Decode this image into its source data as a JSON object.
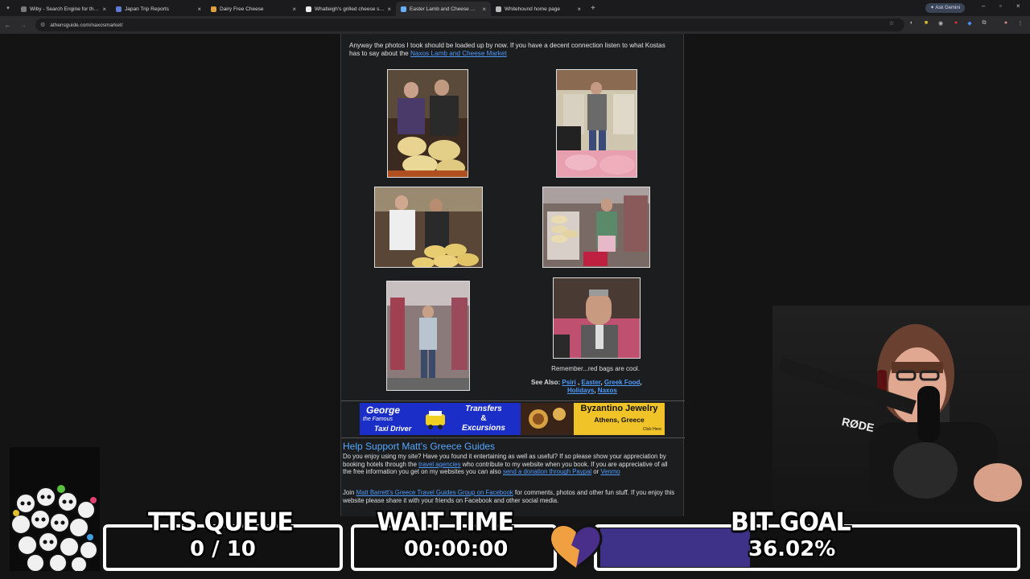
{
  "browser": {
    "tabs": [
      {
        "title": "Wiby - Search Engine for the Cl",
        "color": "#7a7a7a",
        "active": false
      },
      {
        "title": "Japan Trip Reports",
        "color": "#5e7bd6",
        "active": false
      },
      {
        "title": "Dairy Free Cheese",
        "color": "#e0a040",
        "active": false
      },
      {
        "title": "Whatleigh's grilled cheese sand",
        "color": "#eeeeee",
        "active": false
      },
      {
        "title": "Easter Lamb and Cheese Marke",
        "color": "#6ab0ff",
        "active": true
      },
      {
        "title": "Whitehound home page",
        "color": "#bbbbbb",
        "active": false
      }
    ],
    "gemini_label": "Ask Gemini",
    "url": "athensguide.com/naxosmarket/"
  },
  "page": {
    "intro_text": "Anyway the photos I took should be loaded up by now. If you have a decent connection listen to what Kostas has to say about the ",
    "intro_link": "Naxos Lamb and Cheese Market",
    "photo_caption": "Remember...red bags are cool.",
    "see_also_label": "See Also:",
    "see_also_links": [
      "Psiri",
      "Easter",
      "Greek Food",
      "Holidays",
      "Naxos"
    ],
    "banners": [
      {
        "line1": "George",
        "line2": "the Famous",
        "line3": "Taxi Driver"
      },
      {
        "line1": "Transfers",
        "line2": "&",
        "line3": "Excursions"
      },
      {
        "line1": "Byzantino Jewelry",
        "line2": "Athens, Greece",
        "line3": "Click Here"
      }
    ],
    "help_title": "Help Support Matt's Greece Guides",
    "help_p1_a": "Do you enjoy using my site? Have you found it entertaining as well as useful? If so please show your appreciation by booking hotels through the ",
    "help_link_agencies": "travel agencies",
    "help_p1_b": " who contribute to my website when you book. If you are appreciative of all the free information you get on my websites you can also ",
    "help_link_donation": "send a donation through Paypal",
    "help_p1_c": " or ",
    "help_link_venmo": "Venmo",
    "help_p2_a": "Join ",
    "help_link_group": "Matt Barrett's Greece Travel Guides Group on Facebook",
    "help_p2_b": " for comments, photos and other fun stuff. If you enjoy this website please share it with your friends on Facebook and other social media."
  },
  "overlay": {
    "tts_label": "TTS QUEUE",
    "tts_value": "0 / 10",
    "wait_label": "WAIT TIME",
    "wait_value": "00:00:00",
    "bit_label": "BIT GOAL",
    "bit_value": "36.02%",
    "bit_progress": 0.3602,
    "mic_brand": "RØDE"
  }
}
